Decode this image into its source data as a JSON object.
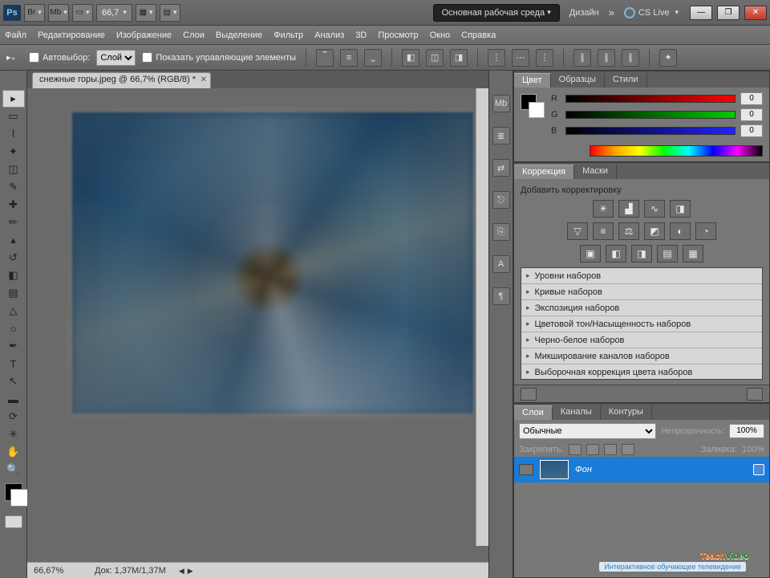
{
  "title": {
    "zoom_dd": "66,7",
    "workspace": "Основная рабочая среда",
    "design": "Дизайн",
    "cslive": "CS Live"
  },
  "menu": [
    "Файл",
    "Редактирование",
    "Изображение",
    "Слои",
    "Выделение",
    "Фильтр",
    "Анализ",
    "3D",
    "Просмотр",
    "Окно",
    "Справка"
  ],
  "options": {
    "autoselect": "Автовыбор:",
    "autoselect_value": "Слой",
    "show_controls": "Показать управляющие элементы"
  },
  "doc": {
    "tab": "снежные горы.jpeg @ 66,7% (RGB/8) *"
  },
  "status": {
    "zoom": "66,67%",
    "doc": "Док: 1,37M/1,37M"
  },
  "color": {
    "tabs": [
      "Цвет",
      "Образцы",
      "Стили"
    ],
    "r": "R",
    "g": "G",
    "b": "B",
    "rv": "0",
    "gv": "0",
    "bv": "0"
  },
  "adjust": {
    "tabs": [
      "Коррекция",
      "Маски"
    ],
    "subtitle": "Добавить корректировку",
    "presets": [
      "Уровни наборов",
      "Кривые наборов",
      "Экспозиция наборов",
      "Цветовой тон/Насыщенность наборов",
      "Черно-белое наборов",
      "Микширование каналов наборов",
      "Выборочная коррекция цвета наборов"
    ]
  },
  "layers": {
    "tabs": [
      "Слои",
      "Каналы",
      "Контуры"
    ],
    "blend": "Обычные",
    "opacity_label": "Непрозрачность:",
    "opacity": "100%",
    "lock_label": "Закрепить:",
    "fill_label": "Заливка:",
    "fill": "100%",
    "layer_name": "Фон"
  },
  "brand": {
    "t1": "Teach",
    "t2": "Video",
    "sub": "Интерактивное обучающее телевидение"
  }
}
